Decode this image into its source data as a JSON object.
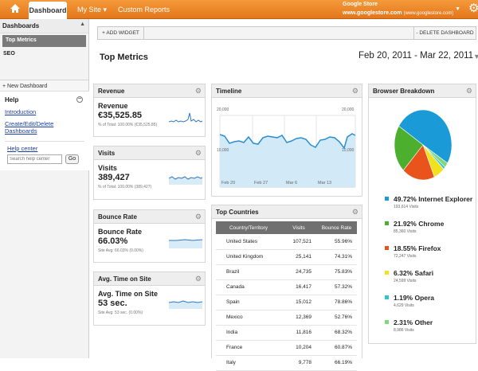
{
  "topbar": {
    "tabs": [
      "Dashboard",
      "My Site",
      "Custom Reports"
    ],
    "my_site_caret": "▾",
    "store_name": "Google Store",
    "store_url": "www.googlestore.com",
    "store_url_paren": "(www.googlestore.com)"
  },
  "sidebar": {
    "header": "Dashboards",
    "items": [
      "Top Metrics",
      "SEO"
    ],
    "new_dashboard": "+ New Dashboard"
  },
  "help": {
    "title": "Help",
    "links": [
      "Introduction",
      "Create/Edit/Delete Dashboards"
    ],
    "help_center": "Help center",
    "search_placeholder": "Search help center",
    "go_label": "Go"
  },
  "toolbar": {
    "add_widget": "+ ADD WIDGET",
    "delete_dashboard": "- DELETE DASHBOARD"
  },
  "page_title": "Top Metrics",
  "date_range": "Feb 20, 2011 - Mar 22, 2011",
  "metrics": [
    {
      "title": "Revenue",
      "label": "Revenue",
      "value": "€35,525.85",
      "sub": "% of Total: 100.00% (€35,525.85)"
    },
    {
      "title": "Visits",
      "label": "Visits",
      "value": "389,427",
      "sub": "% of Total: 100.00% (389,427)"
    },
    {
      "title": "Bounce Rate",
      "label": "Bounce Rate",
      "value": "66.03%",
      "sub": "Site Avg: 66.03% (0.00%)"
    },
    {
      "title": "Avg. Time on Site",
      "label": "Avg. Time on Site",
      "value": "53 sec.",
      "sub": "Site Avg: 53 sec. (0.00%)"
    }
  ],
  "timeline": {
    "title": "Timeline",
    "y_left_top": "20,000",
    "y_left_mid": "10,000",
    "y_right_top": "20,000",
    "y_right_mid": "10,000",
    "x_labels": [
      "Feb 20",
      "Feb 27",
      "Mar 6",
      "Mar 13"
    ]
  },
  "countries": {
    "title": "Top Countries",
    "headers": [
      "Country/Territory",
      "Visits",
      "Bounce Rate"
    ],
    "rows": [
      [
        "United States",
        "107,521",
        "55.96%"
      ],
      [
        "United Kingdom",
        "25,141",
        "74.31%"
      ],
      [
        "Brazil",
        "24,735",
        "75.83%"
      ],
      [
        "Canada",
        "16,417",
        "57.32%"
      ],
      [
        "Spain",
        "15,012",
        "78.86%"
      ],
      [
        "Mexico",
        "12,369",
        "52.76%"
      ],
      [
        "India",
        "11,816",
        "68.32%"
      ],
      [
        "France",
        "10,204",
        "60.87%"
      ],
      [
        "Italy",
        "9,778",
        "66.19%"
      ]
    ]
  },
  "browser": {
    "title": "Browser Breakdown",
    "items": [
      {
        "pct": "49.72% Internet Explorer",
        "visits": "193,614 Visits",
        "share": 49.72,
        "color": "#1a9ad6"
      },
      {
        "pct": "21.92% Chrome",
        "visits": "85,360 Visits",
        "share": 21.92,
        "color": "#4caf2e"
      },
      {
        "pct": "18.55% Firefox",
        "visits": "72,247 Visits",
        "share": 18.55,
        "color": "#e8541c"
      },
      {
        "pct": "6.32% Safari",
        "visits": "24,599 Visits",
        "share": 6.32,
        "color": "#f1e21d"
      },
      {
        "pct": "1.19% Opera",
        "visits": "4,629 Visits",
        "share": 1.19,
        "color": "#2ec4d6"
      },
      {
        "pct": "2.31% Other",
        "visits": "8,986 Visits",
        "share": 2.31,
        "color": "#7fd87c"
      }
    ]
  }
}
